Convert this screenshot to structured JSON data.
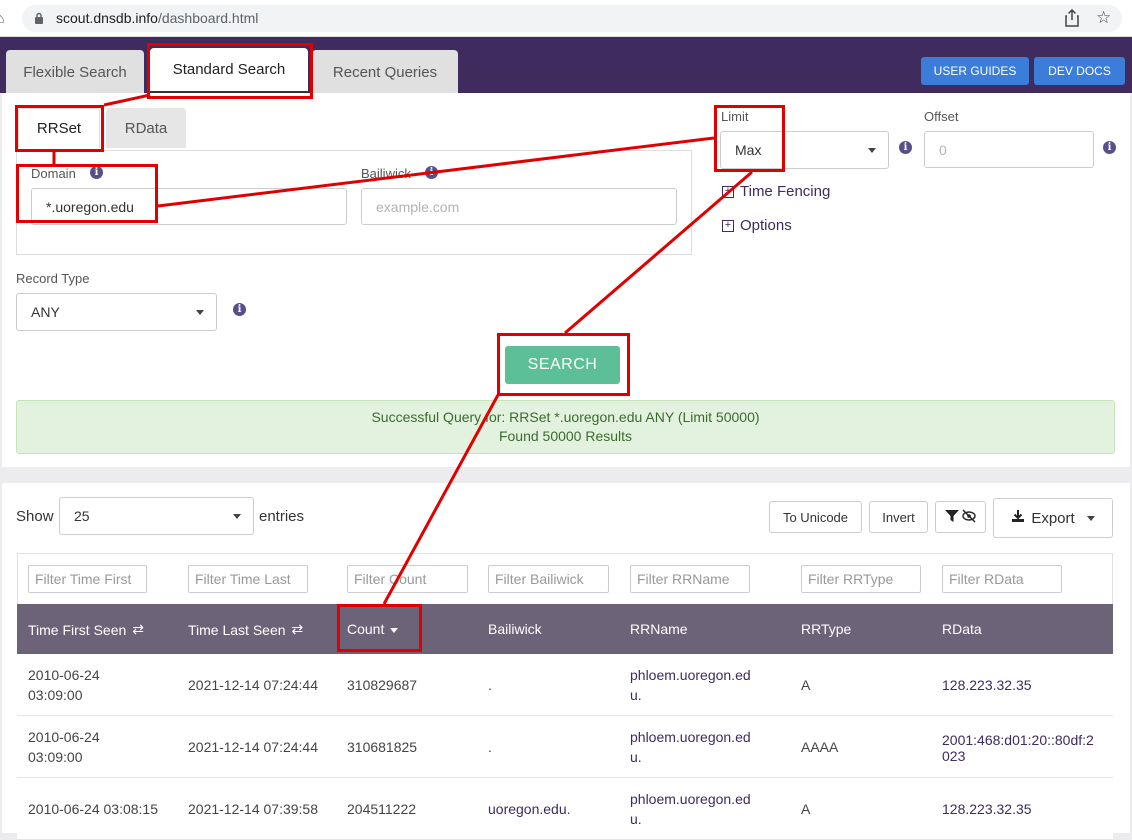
{
  "browser": {
    "url_host": "scout.dnsdb.info",
    "url_path": "/dashboard.html"
  },
  "nav": {
    "tabs": [
      {
        "label": "Flexible Search",
        "active": false
      },
      {
        "label": "Standard Search",
        "active": true
      },
      {
        "label": "Recent Queries",
        "active": false
      }
    ],
    "user_guides": "USER GUIDES",
    "dev_docs": "DEV DOCS"
  },
  "query": {
    "subtabs": [
      {
        "label": "RRSet",
        "active": true
      },
      {
        "label": "RData",
        "active": false
      }
    ],
    "domain_label": "Domain",
    "domain_value": "*.uoregon.edu",
    "bailiwick_label": "Bailiwick",
    "bailiwick_placeholder": "example.com",
    "limit_label": "Limit",
    "limit_value": "Max",
    "offset_label": "Offset",
    "offset_placeholder": "0",
    "time_fencing": "Time Fencing",
    "options": "Options",
    "record_type_label": "Record Type",
    "record_type_value": "ANY",
    "search_button": "SEARCH"
  },
  "status": {
    "line1": "Successful Query for: RRSet *.uoregon.edu ANY (Limit 50000)",
    "line2": "Found 50000 Results"
  },
  "results": {
    "show_label": "Show",
    "entries_value": "25",
    "entries_label": "entries",
    "to_unicode": "To Unicode",
    "invert": "Invert",
    "export": "Export",
    "filters": [
      "Filter Time First",
      "Filter Time Last",
      "Filter Count",
      "Filter Bailiwick",
      "Filter RRName",
      "Filter RRType",
      "Filter RData"
    ],
    "columns": [
      "Time First Seen",
      "Time Last Seen",
      "Count",
      "Bailiwick",
      "RRName",
      "RRType",
      "RData"
    ],
    "rows": [
      {
        "time_first": [
          "2010-06-24",
          "03:09:00"
        ],
        "time_last": "2021-12-14 07:24:44",
        "count": "310829687",
        "bailiwick": ".",
        "rrname": [
          "phloem.uoregon.ed",
          "u."
        ],
        "rrtype": "A",
        "rdata": [
          "128.223.32.35"
        ]
      },
      {
        "time_first": [
          "2010-06-24",
          "03:09:00"
        ],
        "time_last": "2021-12-14 07:24:44",
        "count": "310681825",
        "bailiwick": ".",
        "rrname": [
          "phloem.uoregon.ed",
          "u."
        ],
        "rrtype": "AAAA",
        "rdata": [
          "2001:468:d01:20::80df:2",
          "023"
        ]
      },
      {
        "time_first": [
          "2010-06-24 03:08:15"
        ],
        "time_last": "2021-12-14 07:39:58",
        "count": "204511222",
        "bailiwick": "uoregon.edu.",
        "rrname": [
          "phloem.uoregon.ed",
          "u."
        ],
        "rrtype": "A",
        "rdata": [
          "128.223.32.35"
        ]
      }
    ]
  },
  "colors": {
    "nav_purple": "#3f2b5d",
    "header_gray_purple": "#6c6379",
    "search_green": "#5cbf98",
    "alert_green_bg": "#e3f2de",
    "annotation_red": "#e00000",
    "button_blue": "#3b7dd8"
  }
}
